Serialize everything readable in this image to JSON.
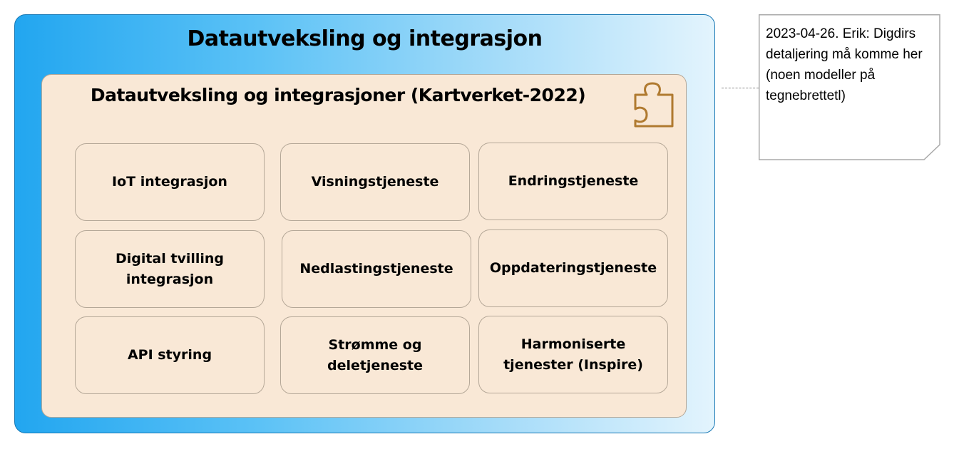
{
  "outer": {
    "title": "Datautveksling og integrasjon"
  },
  "inner": {
    "title": "Datautveksling og integrasjoner (Kartverket-2022)",
    "icon": "puzzle-icon",
    "cells": [
      "IoT integrasjon",
      "Visningstjeneste",
      "Endringstjeneste",
      "Digital tvilling integrasjon",
      "Nedlastingstjeneste",
      "Oppdateringstjeneste",
      "API styring",
      "Strømme og deletjeneste",
      "Harmoniserte tjenester (Inspire)"
    ]
  },
  "note": {
    "text": "2023-04-26. Erik: Digdirs detaljering må komme her (noen modeller på tegnebrettetl)"
  },
  "colors": {
    "outer_left": "#22a6f0",
    "outer_right": "#e3f4fd",
    "inner_fill": "#f9e8d6",
    "icon": "#b07a30"
  }
}
